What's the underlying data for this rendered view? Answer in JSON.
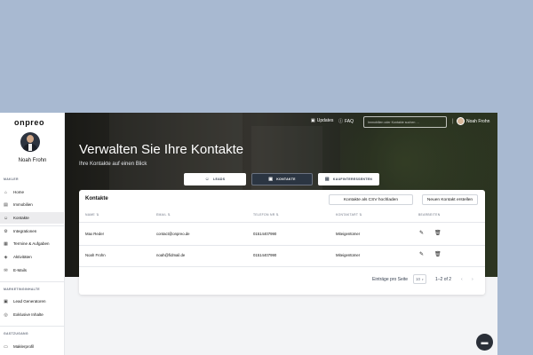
{
  "sidebar": {
    "logo": "onpreo",
    "user_name": "Noah Frohn",
    "sections": [
      "MAKLER",
      "MARKETINGINHALTE",
      "GASTZUGANG"
    ],
    "items": [
      {
        "label": "Home",
        "icon": "home-icon",
        "glyph": "⌂"
      },
      {
        "label": "Immobilien",
        "icon": "building-icon",
        "glyph": "▤"
      },
      {
        "label": "Kontakte",
        "icon": "contacts-icon",
        "glyph": "☺",
        "active": true
      },
      {
        "label": "Integrationen",
        "icon": "integrations-icon",
        "glyph": "⚙"
      },
      {
        "label": "Termine & Aufgaben",
        "icon": "calendar-icon",
        "glyph": "▦"
      },
      {
        "label": "Aktivitäten",
        "icon": "activity-icon",
        "glyph": "◈"
      },
      {
        "label": "E-Mails",
        "icon": "mail-icon",
        "glyph": "✉"
      },
      {
        "label": "Lead Generatoren",
        "icon": "lead-generator-icon",
        "glyph": "▣"
      },
      {
        "label": "Exklusive Inhalte",
        "icon": "exclusive-icon",
        "glyph": "◎"
      },
      {
        "label": "Maklerprofil",
        "icon": "profile-icon",
        "glyph": "▭"
      }
    ]
  },
  "topbar": {
    "updates": "Updates",
    "faq": "FAQ",
    "search_placeholder": "Immobilien oder Kontakte suchen …",
    "user_name": "Noah Frohn"
  },
  "hero": {
    "title": "Verwalten Sie Ihre Kontakte",
    "subtitle": "Ihre Kontakte auf einen Blick"
  },
  "tabs": [
    {
      "label": "LEADS",
      "glyph": "☺"
    },
    {
      "label": "KONTAKTE",
      "glyph": "▣"
    },
    {
      "label": "KAUFINTERESSENTEN",
      "glyph": "▤"
    }
  ],
  "table": {
    "title": "Kontakte",
    "csv_button": "Kontakte als CSV hochladen",
    "new_button": "Neuen Kontakt erstellen",
    "headers": [
      "NAME ⇅",
      "EMAIL ⇅",
      "TELEFON NR ⇅",
      "KONTAKTART ⇅",
      "BEARBEITEN"
    ],
    "rows": [
      {
        "name": "Max Reder",
        "email": "contact@onpreo.de",
        "phone": "01514407990",
        "type": "Miteigentümer"
      },
      {
        "name": "Noah Frohn",
        "email": "noah@fidmail.de",
        "phone": "01514407990",
        "type": "Miteigentümer"
      }
    ]
  },
  "pagination": {
    "per_page_label": "Einträge pro Seite",
    "per_page_value": "10",
    "range": "1–2 of 2",
    "prev": "‹",
    "next": "›"
  },
  "icons": {
    "updates": "updates-icon",
    "faq": "help-icon",
    "edit": "pencil-icon",
    "delete": "trash-icon",
    "chat": "chat-icon"
  },
  "colors": {
    "page_bg": "#a8b9d1",
    "active_tab": "#2b3542",
    "accent_dark": "#2a2f38"
  }
}
